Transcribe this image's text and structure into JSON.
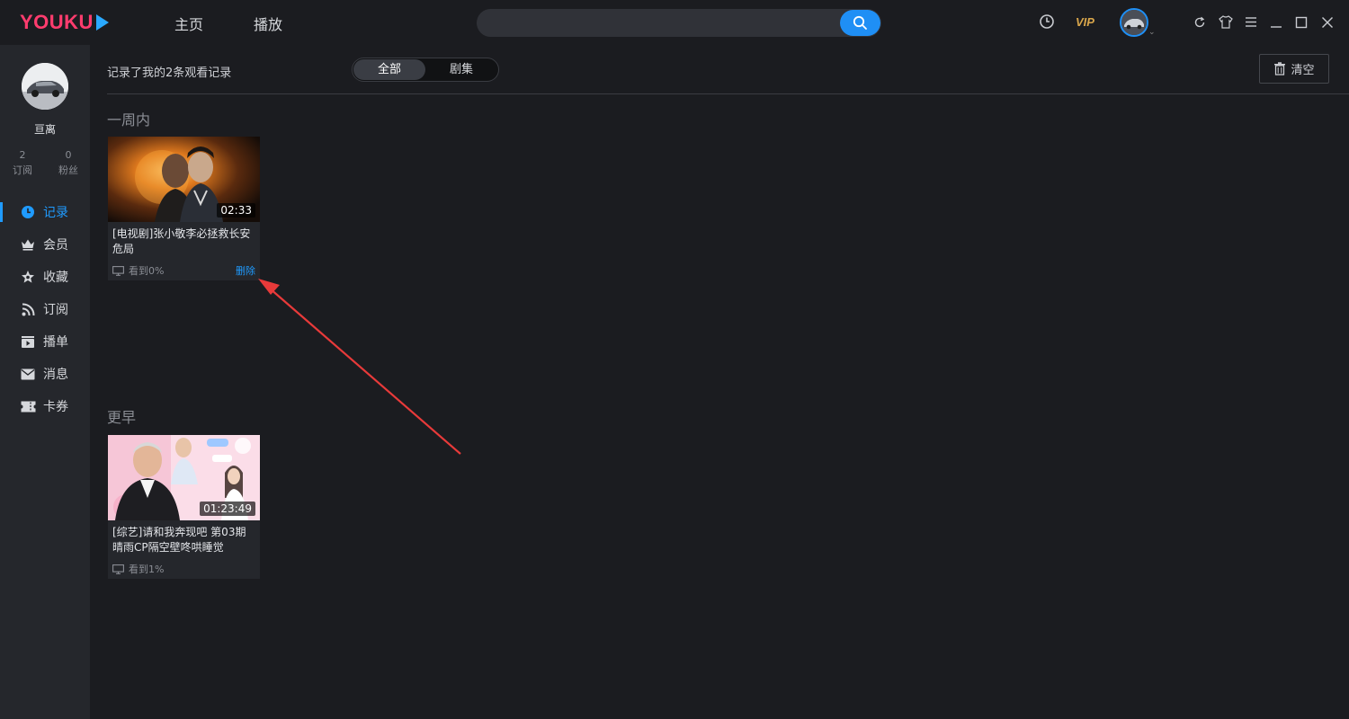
{
  "app": {
    "logo_text": "YOUKU"
  },
  "topbar": {
    "nav": [
      "主页",
      "播放"
    ],
    "search": {
      "placeholder": ""
    },
    "vip_label": "VIP",
    "icons": [
      "history-icon",
      "refresh-icon",
      "skin-icon",
      "menu-icon",
      "minimize-icon",
      "maximize-icon",
      "close-icon"
    ]
  },
  "sidebar": {
    "username": "亘离",
    "stats": [
      {
        "value": "2",
        "label": "订阅"
      },
      {
        "value": "0",
        "label": "粉丝"
      }
    ],
    "menu": [
      {
        "label": "记录",
        "icon": "clock-icon",
        "active": true
      },
      {
        "label": "会员",
        "icon": "crown-icon",
        "active": false
      },
      {
        "label": "收藏",
        "icon": "star-icon",
        "active": false
      },
      {
        "label": "订阅",
        "icon": "rss-icon",
        "active": false
      },
      {
        "label": "播单",
        "icon": "playlist-icon",
        "active": false
      },
      {
        "label": "消息",
        "icon": "mail-icon",
        "active": false
      },
      {
        "label": "卡券",
        "icon": "ticket-icon",
        "active": false
      }
    ]
  },
  "main": {
    "record_count_text": "记录了我的2条观看记录",
    "filter": {
      "all": "全部",
      "series": "剧集"
    },
    "clear_label": "清空",
    "sections": [
      {
        "title": "一周内",
        "items": [
          {
            "title": "[电视剧]张小敬李必拯救长安危局",
            "duration": "02:33",
            "progress": "看到0%",
            "delete_label": "删除"
          }
        ]
      },
      {
        "title": "更早",
        "items": [
          {
            "title": "[综艺]请和我奔现吧 第03期 晴雨CP隔空壁咚哄睡觉",
            "duration": "01:23:49",
            "progress": "看到1%"
          }
        ]
      }
    ]
  },
  "colors": {
    "accent": "#1f8ff5",
    "logo": "#ff3c6e",
    "vip": "#d9a64b",
    "annotation_arrow": "#e83a3a"
  }
}
